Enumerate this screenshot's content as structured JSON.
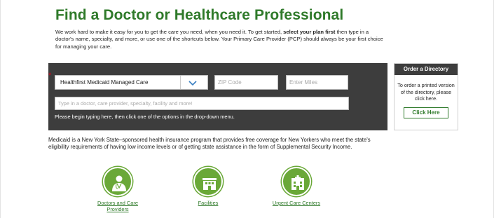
{
  "header": {
    "title": "Find a Doctor or Healthcare Professional",
    "intro_part1": "We work hard to make it easy for you to get the care you need, when you need it. To get started, ",
    "intro_bold": "select your plan first",
    "intro_part2": " then type in a doctor's name, specialty, and more, or use one of the shortcuts below. Your Primary Care Provider (PCP) should always be your first choice for managing your care."
  },
  "search": {
    "required_marker": "*",
    "plan_value": "Healthfirst Medicaid Managed Care",
    "zip_placeholder": "ZIP Code",
    "miles_placeholder": "Enter Miles",
    "provider_placeholder": "Type in a doctor, care provider, specialty, facility and more!",
    "hint": "Please begin typing here, then click one of the options in the drop-down menu."
  },
  "directory": {
    "heading": "Order a Directory",
    "text": "To order a printed version of the directory, please click here.",
    "button_label": "Click Here"
  },
  "medicaid_text": "Medicaid is a New York State–sponsored health insurance program that provides free coverage for New Yorkers who meet the state's eligibility requirements of having low income levels or of getting state assistance in the form of Supplemental Security Income.",
  "shortcuts": [
    {
      "label": "Doctors and Care Providers",
      "icon": "doctor-icon"
    },
    {
      "label": "Facilities",
      "icon": "building-icon"
    },
    {
      "label": "Urgent Care Centers",
      "icon": "urgent-care-icon"
    }
  ],
  "colors": {
    "brand_green": "#2f7a2a",
    "icon_green": "#6aa838",
    "panel_dark": "#3d3d3d",
    "required_red": "#d0021b"
  }
}
